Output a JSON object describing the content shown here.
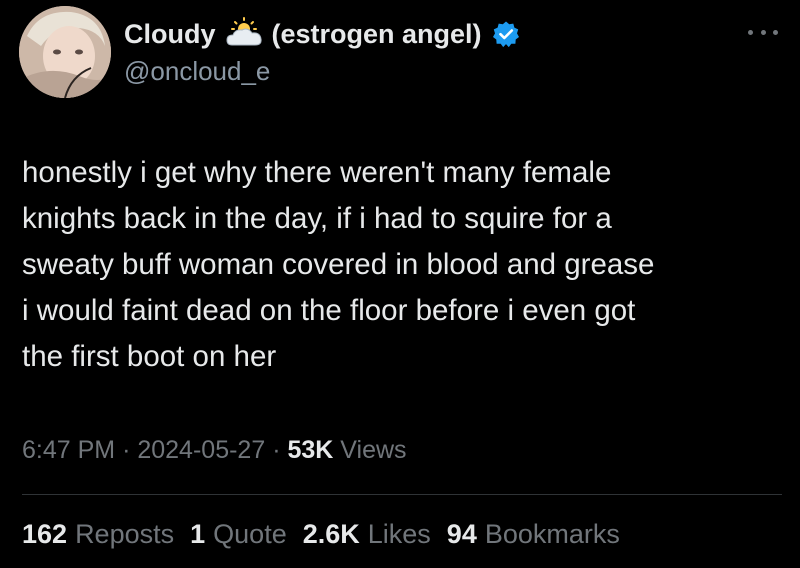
{
  "author": {
    "display_name_start": "Cloudy",
    "display_name_end": "(estrogen angel)",
    "handle": "@oncloud_e",
    "emoji_icon": "sun-behind-cloud-icon",
    "verified_icon": "verified-badge-icon",
    "verified_color": "#1d9bf0"
  },
  "tweet": {
    "text": "honestly i get why there weren't many female\nknights back in the day, if i had to squire for a\nsweaty buff woman covered in blood and grease\ni would faint dead on the floor before i even got\nthe first boot on her"
  },
  "meta": {
    "time": "6:47 PM",
    "separator": "·",
    "date": "2024-05-27",
    "views_count": "53K",
    "views_label": "Views"
  },
  "stats": {
    "reposts_count": "162",
    "reposts_label": "Reposts",
    "quotes_count": "1",
    "quotes_label": "Quote",
    "likes_count": "2.6K",
    "likes_label": "Likes",
    "bookmarks_count": "94",
    "bookmarks_label": "Bookmarks"
  },
  "colors": {
    "background": "#000000",
    "text_primary": "#e7e9ea",
    "text_secondary": "#71767b",
    "divider": "#2f3336"
  }
}
